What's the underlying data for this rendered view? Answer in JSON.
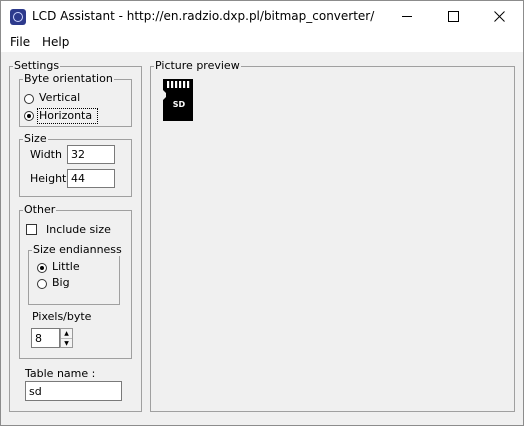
{
  "window": {
    "title": "LCD Assistant -  http://en.radzio.dxp.pl/bitmap_converter/",
    "icon": "app-logo-icon",
    "controls": [
      "minimize-icon",
      "maximize-icon",
      "close-icon"
    ]
  },
  "menu": {
    "file": "File",
    "help": "Help"
  },
  "settings": {
    "label": "Settings",
    "byte_orientation": {
      "label": "Byte orientation",
      "vertical": "Vertical",
      "horizontal": "Horizonta",
      "selected": "Horizonta"
    },
    "size": {
      "label": "Size",
      "width_label": "Width",
      "width_value": "32",
      "height_label": "Height",
      "height_value": "44"
    },
    "other": {
      "label": "Other",
      "include_size": "Include size",
      "include_size_checked": false,
      "endianness": {
        "label": "Size endianness",
        "little": "Little",
        "big": "Big",
        "selected": "Little"
      },
      "pixels_per_byte_label": "Pixels/byte",
      "pixels_per_byte_value": "8"
    },
    "table_name": {
      "label": "Table name :",
      "value": "sd"
    }
  },
  "preview": {
    "label": "Picture preview",
    "image_text": "SD"
  },
  "colors": {
    "frame": "#f0f0f0",
    "border": "#a0a0a0",
    "titlebar": "#ffffff"
  }
}
